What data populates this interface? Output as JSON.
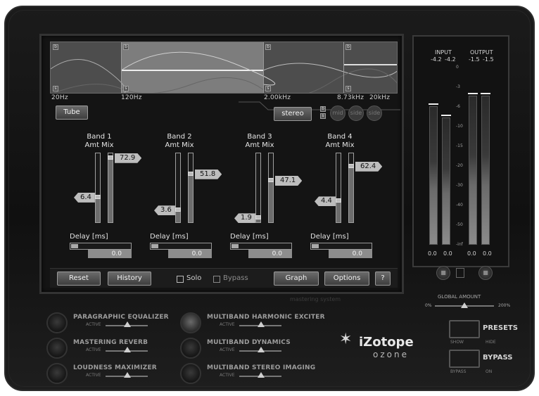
{
  "spectrum": {
    "freq_labels": [
      "20Hz",
      "120Hz",
      "2.00kHz",
      "8.73kHz",
      "20kHz"
    ],
    "band_markers": [
      "b",
      "s"
    ]
  },
  "display": {
    "mode_button": "Tube",
    "stereo_button": "stereo",
    "mode_pills": [
      "mid",
      "side",
      "side"
    ]
  },
  "bands": [
    {
      "title": "Band 1",
      "subtitle": "Amt Mix",
      "amount": "6.4",
      "mix": "72.9",
      "delay_label": "Delay [ms]",
      "delay": "0.0",
      "amount_level": 0.36,
      "mix_level": 0.97
    },
    {
      "title": "Band 2",
      "subtitle": "Amt Mix",
      "amount": "3.6",
      "mix": "51.8",
      "delay_label": "Delay [ms]",
      "delay": "0.0",
      "amount_level": 0.16,
      "mix_level": 0.72
    },
    {
      "title": "Band 3",
      "subtitle": "Amt Mix",
      "amount": "1.9",
      "mix": "47.1",
      "delay_label": "Delay [ms]",
      "delay": "0.0",
      "amount_level": 0.04,
      "mix_level": 0.62
    },
    {
      "title": "Band 4",
      "subtitle": "Amt Mix",
      "amount": "4.4",
      "mix": "62.4",
      "delay_label": "Delay [ms]",
      "delay": "0.0",
      "amount_level": 0.3,
      "mix_level": 0.84
    }
  ],
  "toolbar": {
    "reset": "Reset",
    "history": "History",
    "solo": "Solo",
    "bypass": "Bypass",
    "graph": "Graph",
    "options": "Options",
    "help": "?"
  },
  "brand_strip": "mastering system",
  "meters": {
    "input_label": "INPUT",
    "output_label": "OUTPUT",
    "input_peaks": [
      "-4.2",
      "-4.2"
    ],
    "output_peaks": [
      "-1.5",
      "-1.5"
    ],
    "scale": [
      "0",
      "-3",
      "-6",
      "-10",
      "-15",
      "-20",
      "-30",
      "-40",
      "-50",
      "-inf"
    ],
    "values": [
      "0.0",
      "0.0",
      "0.0",
      "0.0"
    ],
    "input_levels": [
      0.78,
      0.72
    ],
    "output_levels": [
      0.84,
      0.84
    ]
  },
  "global": {
    "label": "GLOBAL AMOUNT",
    "min": "0%",
    "max": "200%",
    "level": 0.5
  },
  "modules": [
    {
      "name": "PARAGRAPHIC EQUALIZER",
      "active": "ACTIVE",
      "lit": false
    },
    {
      "name": "MASTERING REVERB",
      "active": "ACTIVE",
      "lit": false
    },
    {
      "name": "LOUDNESS MAXIMIZER",
      "active": "ACTIVE",
      "lit": false
    },
    {
      "name": "MULTIBAND HARMONIC EXCITER",
      "active": "ACTIVE",
      "lit": true
    },
    {
      "name": "MULTIBAND DYNAMICS",
      "active": "ACTIVE",
      "lit": false
    },
    {
      "name": "MULTIBAND STEREO IMAGING",
      "active": "ACTIVE",
      "lit": false
    }
  ],
  "brand": {
    "name": "iZotope",
    "product": "ozone"
  },
  "presets": {
    "label": "PRESETS",
    "show": "SHOW",
    "hide": "HIDE"
  },
  "bypass": {
    "label": "BYPASS",
    "bypass": "BYPASS",
    "on": "ON"
  },
  "colors": {
    "frame": "#151515",
    "screen": "#141414",
    "spectrum_bg": "#4d4d4d",
    "band_highlight": "#7d7d7d",
    "value_tag": "#bdbdbd"
  }
}
